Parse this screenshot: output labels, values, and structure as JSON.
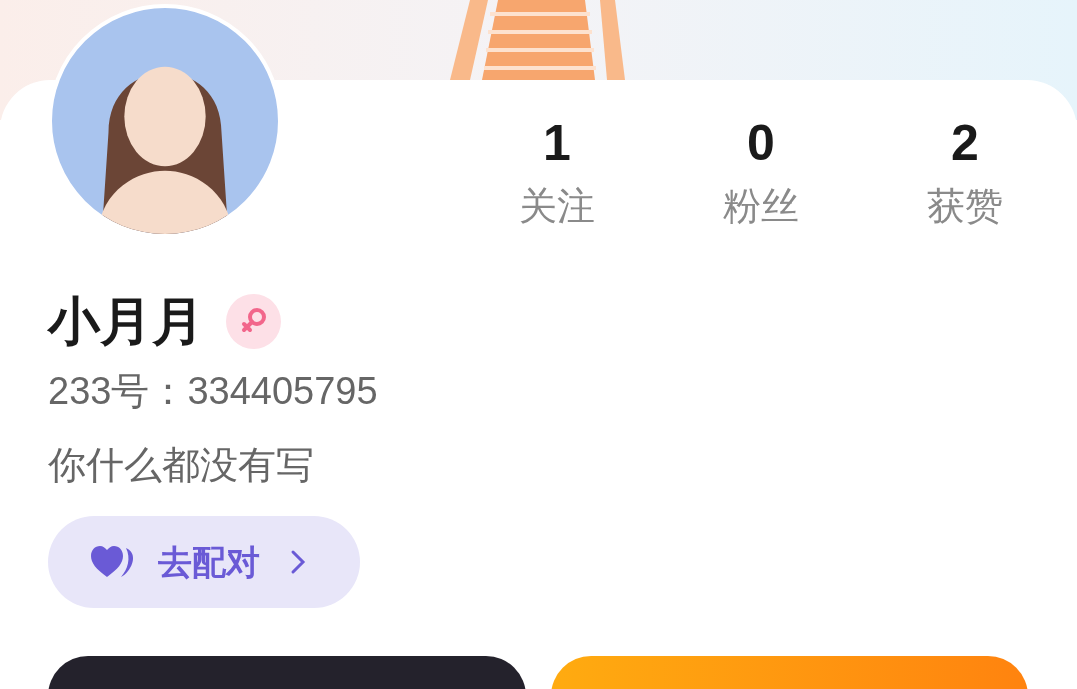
{
  "stats": [
    {
      "value": "1",
      "label": "关注"
    },
    {
      "value": "0",
      "label": "粉丝"
    },
    {
      "value": "2",
      "label": "获赞"
    }
  ],
  "profile": {
    "name": "小月月",
    "gender_icon": {
      "kind": "female"
    },
    "id_text": "233号：334405795",
    "bio": "你什么都没有写"
  },
  "pair_button": {
    "label": "去配对"
  }
}
